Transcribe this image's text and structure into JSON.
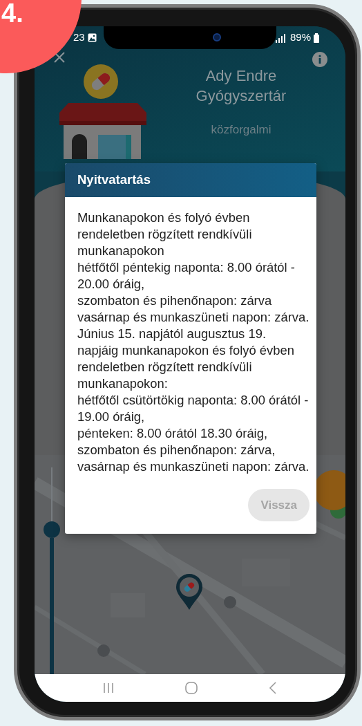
{
  "badge": {
    "text": "4."
  },
  "status_bar": {
    "time": "23",
    "battery": "89%"
  },
  "pharmacy": {
    "name": "Ady Endre Gyógyszertár",
    "type": "közforgalmi"
  },
  "distance_slider": {
    "level": 0.7
  },
  "dialog": {
    "title": "Nyitvatartás",
    "lines": [
      "Munkanapokon és folyó évben rendeletben rögzített rendkívüli munkanapokon",
      "hétfőtől péntekig naponta: 8.00 órától - 20.00 óráig,",
      "szombaton és pihenőnapon: zárva",
      "vasárnap és munkaszüneti napon: zárva.",
      "Június 15. napjától augusztus 19. napjáig munkanapokon és folyó évben rendeletben rögzített rendkívüli munkanapokon:",
      "hétfőtől csütörtökig naponta: 8.00 órától - 19.00 óráig,",
      "pénteken: 8.00 órától 18.30 óráig,",
      "szombaton és pihenőnapon: zárva,",
      "vasárnap és munkaszüneti napon: zárva."
    ],
    "button": "Vissza"
  }
}
